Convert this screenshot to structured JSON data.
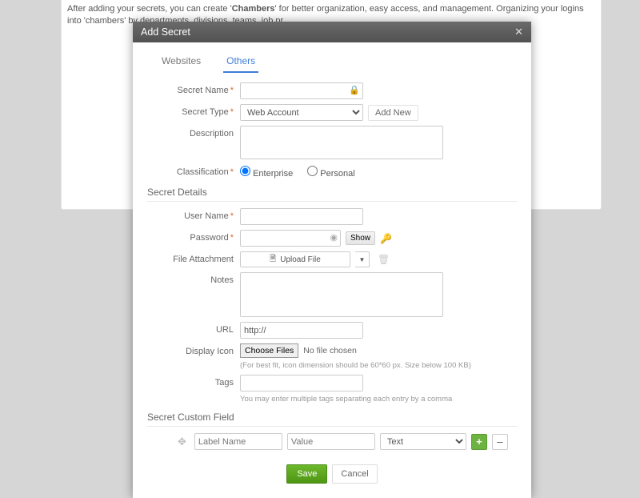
{
  "bg": {
    "text_pre": "After adding your secrets, you can create '",
    "text_bold": "Chambers",
    "text_post": "' for better organization, easy access, and management. Organizing your logins into 'chambers' by departments, divisions, teams, job pr"
  },
  "modal": {
    "title": "Add Secret",
    "tabs": {
      "websites": "Websites",
      "others": "Others"
    },
    "labels": {
      "secret_name": "Secret Name",
      "secret_type": "Secret Type",
      "description": "Description",
      "classification": "Classification",
      "user_name": "User Name",
      "password": "Password",
      "file_attachment": "File Attachment",
      "notes": "Notes",
      "url": "URL",
      "display_icon": "Display Icon",
      "tags": "Tags"
    },
    "secret_type": {
      "selected": "Web Account",
      "add_new": "Add New"
    },
    "classification": {
      "enterprise": "Enterprise",
      "personal": "Personal"
    },
    "sections": {
      "details": "Secret Details",
      "custom": "Secret Custom Field"
    },
    "password": {
      "show": "Show"
    },
    "upload": {
      "label": "Upload File"
    },
    "url_value": "http://",
    "icon": {
      "choose": "Choose Files",
      "no_file": "No file chosen",
      "hint": "(For best fit, icon dimension should be 60*60 px. Size below 100 KB)"
    },
    "tags_hint": "You may enter multiple tags separating each entry by a comma",
    "custom": {
      "label_ph": "Label Name",
      "value_ph": "Value",
      "type": "Text"
    },
    "footer": {
      "save": "Save",
      "cancel": "Cancel"
    }
  }
}
